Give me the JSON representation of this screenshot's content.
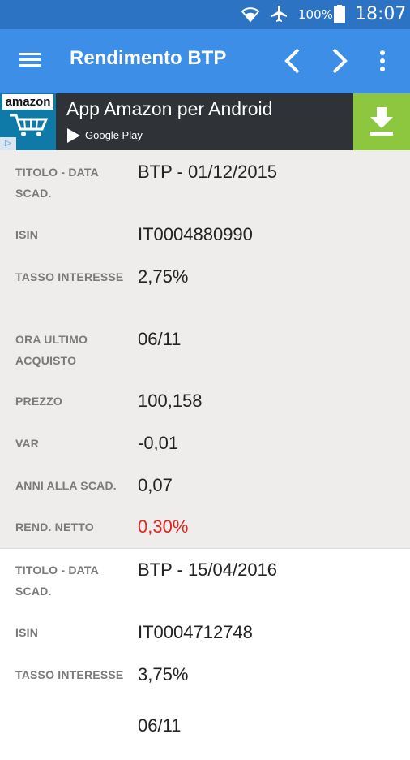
{
  "status_bar": {
    "battery": "100%",
    "time": "18:07",
    "icons": [
      "wifi-icon",
      "airplane-icon",
      "battery-icon"
    ]
  },
  "app_bar": {
    "title": "Rendimento BTP",
    "icons": [
      "menu-icon",
      "chevron-left-icon",
      "chevron-right-icon",
      "more-vert-icon"
    ]
  },
  "ad": {
    "logo_text": "amazon",
    "headline": "App Amazon per Android",
    "store": "Google Play",
    "icons": [
      "cart-icon",
      "play-store-icon",
      "download-icon",
      "adchoices-icon"
    ]
  },
  "bonds": [
    {
      "fields": [
        {
          "label": "TITOLO - DATA SCAD.",
          "value": "BTP - 01/12/2015"
        },
        {
          "label": "ISIN",
          "value": "IT0004880990"
        },
        {
          "label": "TASSO INTERESSE",
          "value": "2,75%"
        },
        {
          "label": "ORA ULTIMO ACQUISTO",
          "value": "06/11"
        },
        {
          "label": "PREZZO",
          "value": "100,158"
        },
        {
          "label": "VAR",
          "value": "-0,01"
        },
        {
          "label": "ANNI ALLA SCAD.",
          "value": "0,07"
        },
        {
          "label": "REND. NETTO",
          "value": "0,30%"
        }
      ]
    },
    {
      "fields": [
        {
          "label": "TITOLO - DATA SCAD.",
          "value": "BTP - 15/04/2016"
        },
        {
          "label": "ISIN",
          "value": "IT0004712748"
        },
        {
          "label": "TASSO INTERESSE",
          "value": "3,75%"
        },
        {
          "label": "",
          "value": "06/11"
        }
      ]
    }
  ],
  "colors": {
    "status_bar": "#2c73c4",
    "app_bar": "#3d8ee6",
    "ad_background": "#2f3337",
    "download_button": "#8dc63f",
    "selected_card": "#efedeb",
    "label_text": "#7a7a7a",
    "negative_yield": "#e8231c"
  }
}
